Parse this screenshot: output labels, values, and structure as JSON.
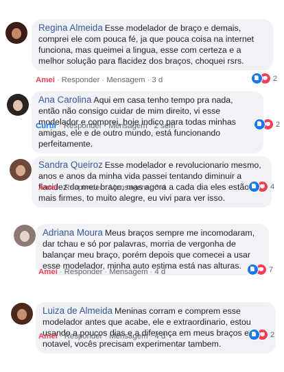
{
  "comments": [
    {
      "author": "Regina Almeida",
      "text": "Esse modelador de braço e demais, comprei ele com pouca fé, ja que pouca coisa na internet funciona, mas queimei a lingua, esse com certeza e a melhor solução para flacidez dos braços, choquei rsrs.",
      "like_label": "Amei",
      "like_color": "#f33e58",
      "reply_label": "Responder",
      "message_label": "Mensagem",
      "time": "3 d",
      "reaction_count": "2",
      "avatar_colors": {
        "hair": "#3b1f16",
        "skin": "#c48a6a"
      }
    },
    {
      "author": "Ana Carolina",
      "text": "Aqui em casa tenho tempo pra nada, então não consigo cuidar de mim direito, vi esse modelador e comprei, hoje indico para todas minhas amigas, ele e de outro mundo, está funcionando perfeitamente.",
      "like_label": "Curtir",
      "like_color": "#1877f2",
      "reply_label": "Responder",
      "message_label": "Mensagem",
      "time": "2 sem",
      "reaction_count": "2",
      "avatar_colors": {
        "hair": "#2a2320",
        "skin": "#e3c1b0"
      }
    },
    {
      "author": "Sandra Queiroz",
      "text": "Esse modelador e revolucionario mesmo, anos e anos da minha vida passei tentando diminuir a flacidez do meu braço, mas agora a cada dia eles estão mais firmes, to muito alegre, eu vivi para ver isso.",
      "like_label": "Amei",
      "like_color": "#f33e58",
      "reply_label": "Responder",
      "message_label": "Mensagem",
      "time": "6 d",
      "reaction_count": "4",
      "avatar_colors": {
        "hair": "#6b4a3a",
        "skin": "#d9a98c"
      }
    },
    {
      "author": "Adriana Moura",
      "text": "Meus braços sempre me incomodaram, dar tchau e só por palavras, morria de vergonha de balançar meu braço, porém depois que comecei a usar esse modelador, minha auto estima está nas alturas.",
      "like_label": "Amei",
      "like_color": "#f33e58",
      "reply_label": "Responder",
      "message_label": "Mensagem",
      "time": "4 d",
      "reaction_count": "7",
      "avatar_colors": {
        "hair": "#8a7a72",
        "skin": "#e6d2c8"
      }
    },
    {
      "author": "Luiza de Almeida",
      "text": "Meninas corram e comprem esse modelador antes que acabe, ele e extraordinario, estou usando a poucos dias e a diferença em meus braços e notavel, vocês precisam experimentar tambem.",
      "like_label": "Amei",
      "like_color": "#f33e58",
      "reply_label": "Responder",
      "message_label": "Mensagem",
      "time": "4 d",
      "reaction_count": "2",
      "avatar_colors": {
        "hair": "#4a2a1c",
        "skin": "#c99070"
      }
    }
  ]
}
